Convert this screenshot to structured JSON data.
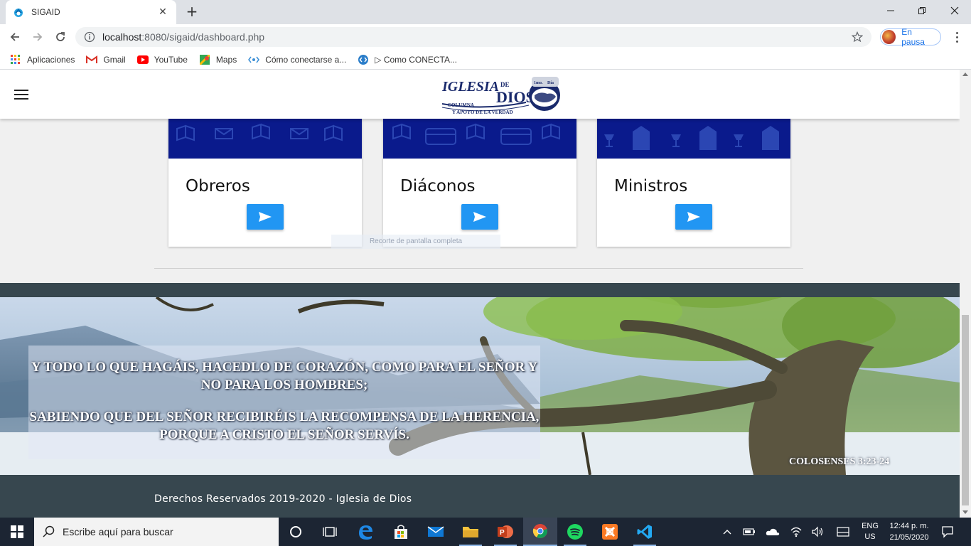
{
  "browser": {
    "tab_title": "SIGAID",
    "url_host": "localhost",
    "url_path": ":8080/sigaid/dashboard.php",
    "profile_label": "En pausa",
    "bookmarks": [
      {
        "label": "Aplicaciones",
        "icon": "apps-grid-icon"
      },
      {
        "label": "Gmail",
        "icon": "gmail-icon"
      },
      {
        "label": "YouTube",
        "icon": "youtube-icon"
      },
      {
        "label": "Maps",
        "icon": "maps-icon"
      },
      {
        "label": "Cómo conectarse a...",
        "icon": "link-icon"
      },
      {
        "label": "▷ Como CONECTA...",
        "icon": "code-icon"
      }
    ]
  },
  "header": {
    "logo_text": {
      "line1": "IGLESIA",
      "line2": "DE",
      "line3": "DIOS",
      "tagline1": "COLUMNA",
      "tagline2": "Y APOYO DE LA VERDAD",
      "badge1": "1mo.",
      "badge2": "Día"
    }
  },
  "cards": [
    {
      "title": "Obreros",
      "button_icon": "send-icon"
    },
    {
      "title": "Diáconos",
      "button_icon": "send-icon"
    },
    {
      "title": "Ministros",
      "button_icon": "send-icon"
    }
  ],
  "overlay_tooltip": "Recorte de pantalla completa",
  "footer": {
    "verse_line1": "Y TODO LO QUE HAGÁIS, HACEDLO DE CORAZÓN, COMO PARA EL SEÑOR Y NO PARA LOS HOMBRES;",
    "verse_line2": "SABIENDO QUE DEL SEÑOR RECIBIRÉIS LA RECOMPENSA DE LA HERENCIA, PORQUE A CRISTO EL SEÑOR SERVÍS.",
    "reference": "COLOSENSES 3:23-24",
    "copyright": "Derechos Reservados 2019-2020 - Iglesia de Dios"
  },
  "taskbar": {
    "search_placeholder": "Escribe aquí para buscar",
    "lang_line1": "ENG",
    "lang_line2": "US",
    "time": "12:44 p. m.",
    "date": "21/05/2020"
  },
  "colors": {
    "card_banner": "#0a1a8c",
    "button": "#2196f3",
    "footer": "#37474f",
    "taskbar": "#1c2533"
  }
}
